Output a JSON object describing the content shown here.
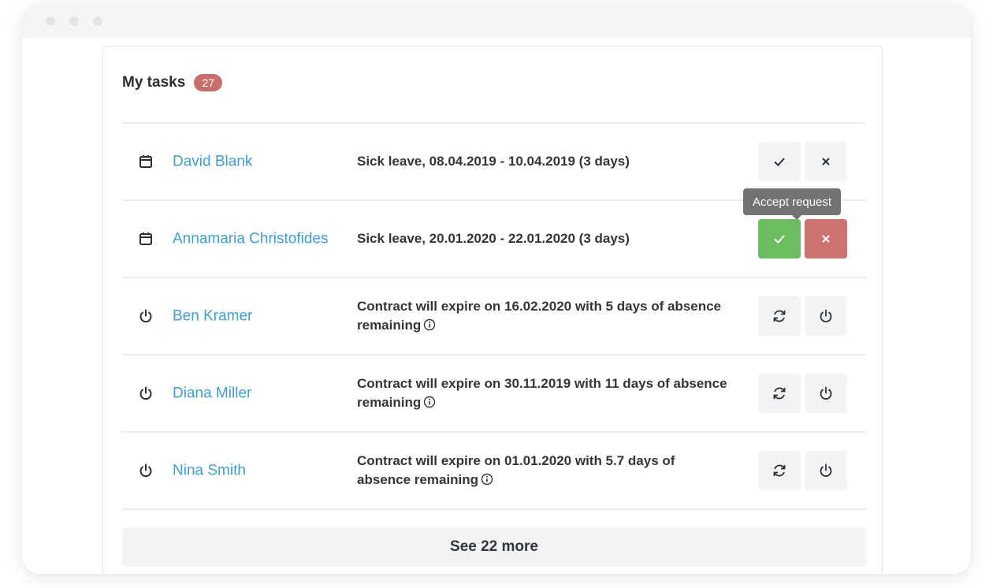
{
  "tasks": {
    "title": "My tasks",
    "count": "27",
    "rows": [
      {
        "icon": "calendar-icon",
        "name": "David Blank",
        "desc": "Sick leave, 08.04.2019 - 10.04.2019 (3 days)",
        "actions": [
          "check-icon",
          "close-icon"
        ]
      },
      {
        "icon": "calendar-icon",
        "name": "Annamaria Christofides",
        "desc": "Sick leave, 20.01.2020 - 22.01.2020 (3 days)",
        "actions": [
          "check-icon",
          "close-icon"
        ],
        "tooltip": "Accept request"
      },
      {
        "icon": "power-icon",
        "name": "Ben Kramer",
        "desc": "Contract will expire on 16.02.2020 with 5 days of absence remaining",
        "actions": [
          "renew-icon",
          "power-icon"
        ],
        "info": true
      },
      {
        "icon": "power-icon",
        "name": "Diana Miller",
        "desc": "Contract will expire on 30.11.2019 with 11 days of absence remaining",
        "actions": [
          "renew-icon",
          "power-icon"
        ],
        "info": true
      },
      {
        "icon": "power-icon",
        "name": "Nina Smith",
        "desc": "Contract will expire on 01.01.2020 with 5.7 days of absence remaining",
        "actions": [
          "renew-icon",
          "power-icon"
        ],
        "info": true
      }
    ],
    "see_more": "See 22 more"
  },
  "colors": {
    "accent_link": "#3d9fd3",
    "badge": "#c96f6b",
    "accept_button": "#6cbc62",
    "reject_button": "#cf7372"
  }
}
